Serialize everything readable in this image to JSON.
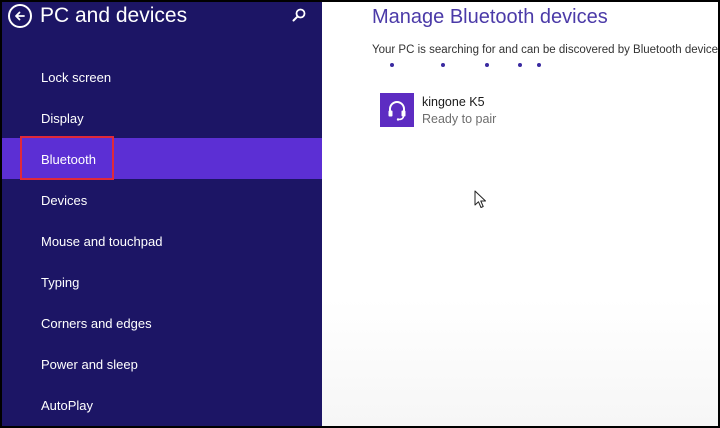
{
  "sidebar": {
    "title": "PC and devices",
    "back_icon": "back-arrow-icon",
    "search_icon": "search-icon",
    "items": [
      {
        "label": "Lock screen"
      },
      {
        "label": "Display"
      },
      {
        "label": "Bluetooth"
      },
      {
        "label": "Devices"
      },
      {
        "label": "Mouse and touchpad"
      },
      {
        "label": "Typing"
      },
      {
        "label": "Corners and edges"
      },
      {
        "label": "Power and sleep"
      },
      {
        "label": "AutoPlay"
      }
    ],
    "selected_item": "Bluetooth"
  },
  "main": {
    "title": "Manage Bluetooth devices",
    "status": "Your PC is searching for and can be discovered by Bluetooth devices",
    "devices": [
      {
        "name": "kingone K5",
        "status": "Ready to pair",
        "icon": "headset-icon"
      }
    ]
  },
  "colors": {
    "sidebar_bg": "#1c1565",
    "selected_bg": "#5c2fd4",
    "accent": "#4b3aa8",
    "highlight": "#e0293a",
    "device_tile": "#5d2cc2"
  }
}
